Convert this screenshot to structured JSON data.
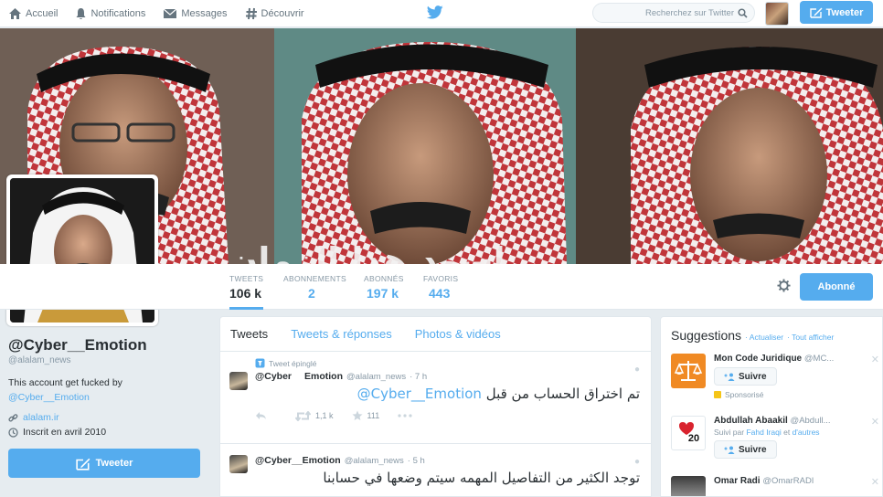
{
  "nav": {
    "home": "Accueil",
    "notifications": "Notifications",
    "messages": "Messages",
    "discover": "Découvrir",
    "search_placeholder": "Recherchez sur Twitter",
    "tweet_button": "Tweeter"
  },
  "banner": {
    "caption": "اسود هذا الزمان"
  },
  "stats": [
    {
      "label": "TWEETS",
      "value": "106 k"
    },
    {
      "label": "ABONNEMENTS",
      "value": "2"
    },
    {
      "label": "ABONNÉS",
      "value": "197 k"
    },
    {
      "label": "FAVORIS",
      "value": "443"
    }
  ],
  "follow_button": "Abonné",
  "profile": {
    "name": "@Cyber__Emotion",
    "handle": "@alalam_news",
    "bio_line1": "This account get fucked by",
    "bio_mention": "@Cyber__Emotion",
    "link": "alalam.ir",
    "joined": "Inscrit en avril 2010",
    "tweet_button": "Tweeter"
  },
  "tabs": [
    "Tweets",
    "Tweets & réponses",
    "Photos & vidéos"
  ],
  "tweets": [
    {
      "pinned": "Tweet épinglé",
      "name_a": "@Cyber",
      "name_b": "Emotion",
      "handle": "@alalam_news",
      "time": "· 7 h",
      "text": "تم اختراق الحساب من قبل",
      "mention": "@Cyber__Emotion",
      "retweets": "1,1 k",
      "favorites": "111"
    },
    {
      "name": "@Cyber__Emotion",
      "handle": "@alalam_news",
      "time": "· 5 h",
      "text": "توجد الكثير من التفاصيل المهمه سيتم وضعها في حسابنا"
    }
  ],
  "suggestions": {
    "title": "Suggestions",
    "refresh": "· Actualiser",
    "view_all": "· Tout afficher",
    "items": [
      {
        "name": "Mon Code Juridique",
        "handle": "@MC...",
        "button": "Suivre",
        "sponsored": "Sponsorisé"
      },
      {
        "name": "Abdullah Abaakil",
        "handle": "@Abdull...",
        "followed_prefix": "Suivi par",
        "followed_by": "Fahd Iraqi",
        "followed_and": "et",
        "followed_rest": "d'autres",
        "button": "Suivre",
        "badge": "20"
      },
      {
        "name": "Omar Radi",
        "handle": "@OmarRADI"
      }
    ]
  },
  "colors": {
    "accent": "#55acee",
    "text": "#292f33",
    "muted": "#8899a6",
    "background": "#e6ecf0"
  }
}
